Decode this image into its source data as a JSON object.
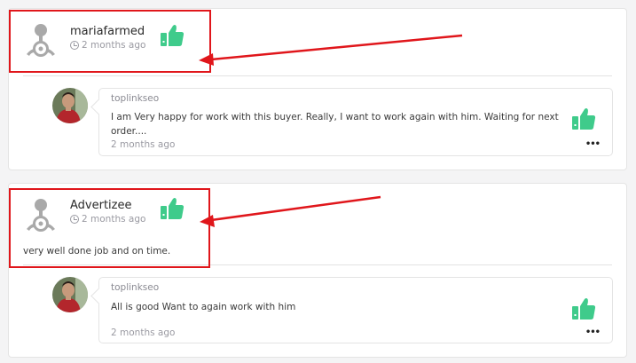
{
  "reviews": [
    {
      "author": "mariafarmed",
      "time": "2 months ago",
      "text": "",
      "reply": {
        "author": "toplinkseo",
        "text": "I am Very happy for work with this buyer. Really, I want to work again with him. Waiting for next order....",
        "time": "2 months ago",
        "more": "•••"
      }
    },
    {
      "author": "Advertizee",
      "time": "2 months ago",
      "text": "very well done job and on time.",
      "reply": {
        "author": "toplinkseo",
        "text": "All is good Want to again work with him",
        "time": "2 months ago",
        "more": "•••"
      }
    }
  ],
  "colors": {
    "thumb": "#3fcb8b",
    "highlight": "#e0161b",
    "avatar": "#a9a9a9"
  },
  "icons": [
    "default-avatar-icon",
    "clock-icon",
    "thumbs-up-icon",
    "more-icon",
    "user-photo"
  ]
}
